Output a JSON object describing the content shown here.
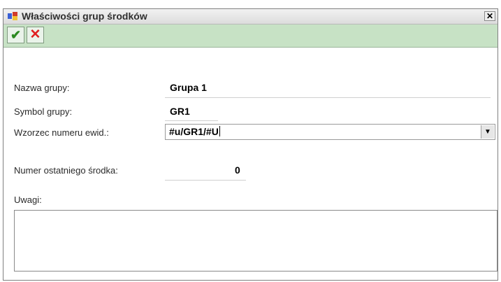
{
  "window": {
    "title": "Właściwości grup środków"
  },
  "titlebar": {
    "close_label": "✕",
    "app_icon": "app-icon"
  },
  "toolbar": {
    "ok_label": "✔",
    "cancel_label": "✕"
  },
  "form": {
    "group_name": {
      "label": "Nazwa grupy:",
      "value": "Grupa 1"
    },
    "group_symbol": {
      "label": "Symbol grupy:",
      "value": "GR1"
    },
    "pattern": {
      "label": "Wzorzec numeru ewid.:",
      "value": "#u/GR1/#U",
      "dropdown_icon": "▼"
    },
    "last_number": {
      "label": "Numer ostatniego środka:",
      "value": "0"
    },
    "notes": {
      "label": "Uwagi:",
      "value": ""
    }
  },
  "colors": {
    "toolbar_bg": "#c7e2c5",
    "ok": "#2c8a21",
    "cancel": "#e02020"
  }
}
